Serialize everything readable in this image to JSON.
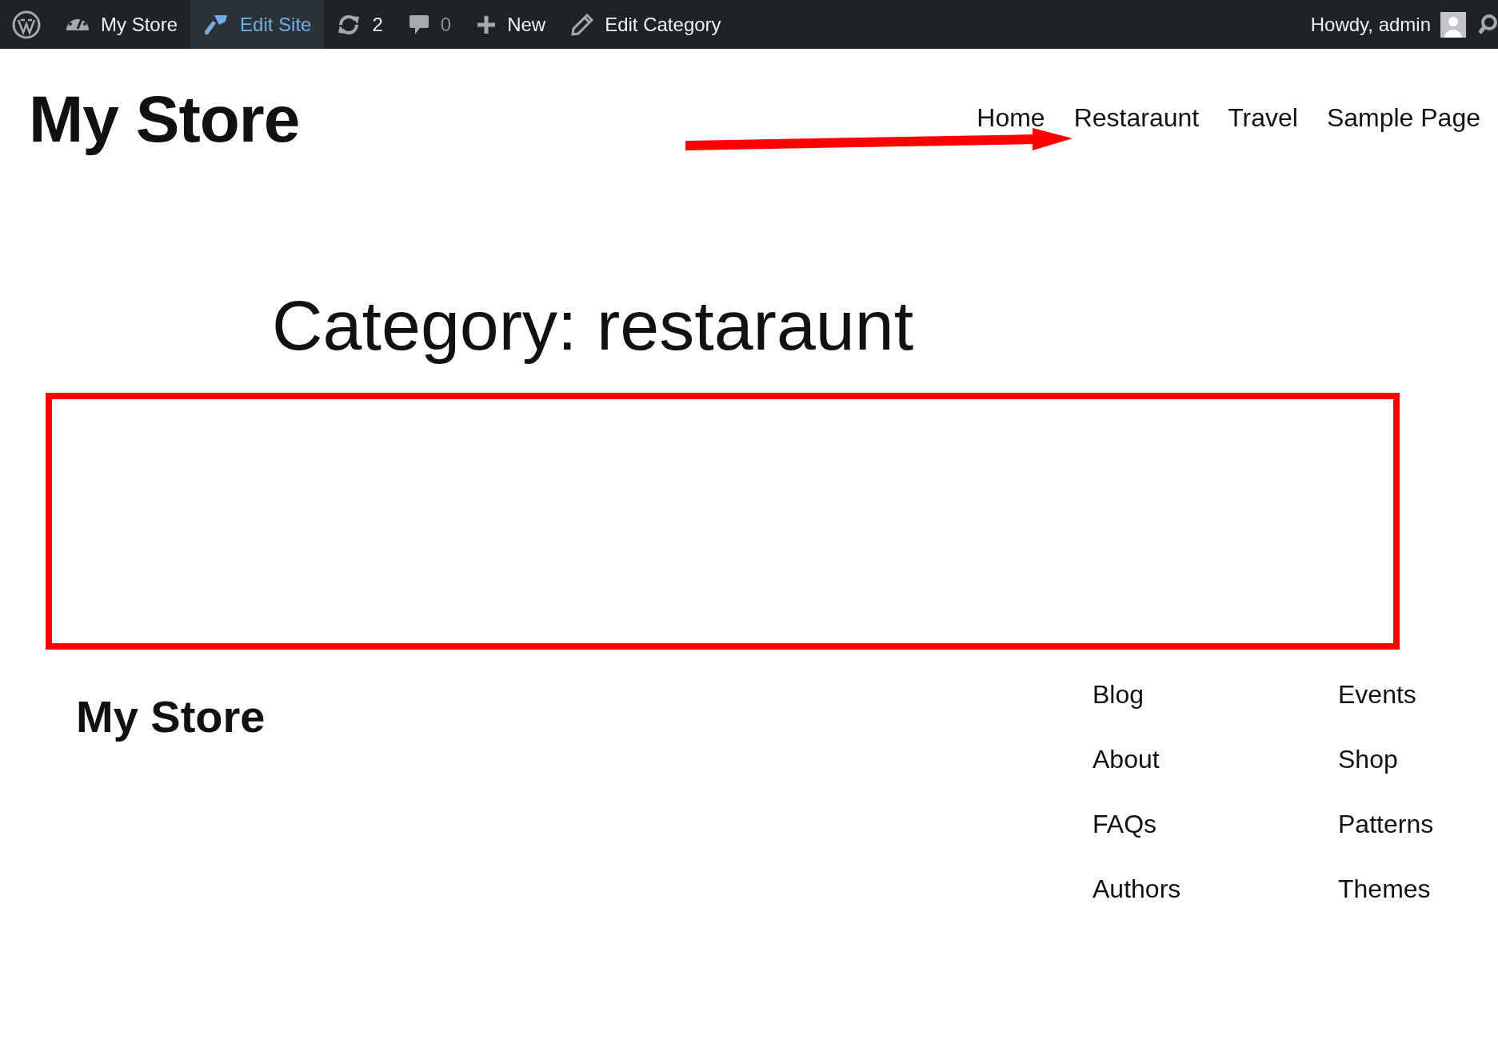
{
  "admin_bar": {
    "items": [
      {
        "kind": "logo",
        "selected": false
      },
      {
        "kind": "dashboard",
        "label": "My Store",
        "selected": false
      },
      {
        "kind": "brush",
        "label": "Edit Site",
        "selected": true
      },
      {
        "kind": "updates",
        "label": "2",
        "selected": false
      },
      {
        "kind": "comments",
        "label": "0",
        "selected": false
      },
      {
        "kind": "new",
        "label": "New",
        "selected": false
      },
      {
        "kind": "pencil",
        "label": "Edit Category",
        "selected": false
      }
    ],
    "greeting": "Howdy, admin"
  },
  "header": {
    "title": "My Store",
    "nav": [
      "Home",
      "Restaraunt",
      "Travel",
      "Sample Page"
    ]
  },
  "main": {
    "heading": "Category: restaraunt"
  },
  "footer": {
    "title": "My Store",
    "columns": [
      [
        "Blog",
        "About",
        "FAQs",
        "Authors"
      ],
      [
        "Events",
        "Shop",
        "Patterns",
        "Themes"
      ]
    ]
  }
}
